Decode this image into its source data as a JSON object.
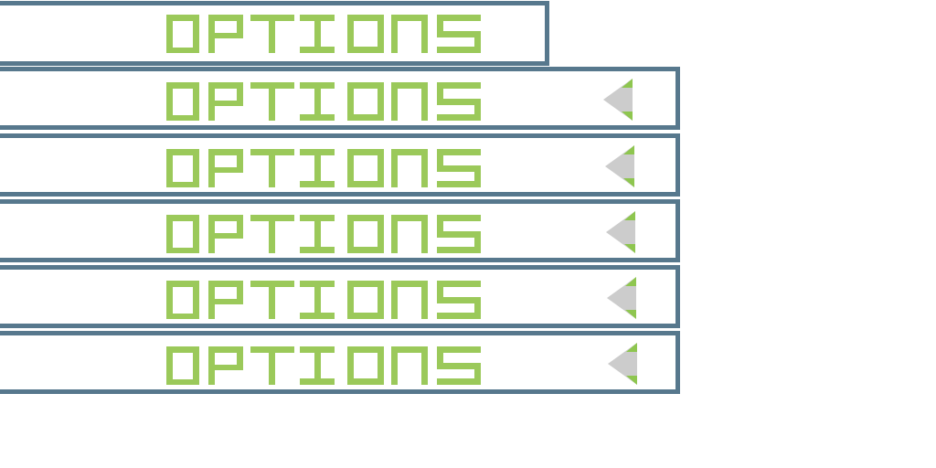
{
  "menu": {
    "buttons": [
      {
        "label": "OPTIONS"
      },
      {
        "label": "OPTIONS"
      },
      {
        "label": "OPTIONS"
      },
      {
        "label": "OPTIONS"
      },
      {
        "label": "OPTIONS"
      },
      {
        "label": "OPTIONS"
      }
    ],
    "arrow_icon": "left-triangle-icon"
  },
  "colors": {
    "border": "#57788d",
    "text": "#9bc95a",
    "arrow_fill": "#cccccc",
    "arrow_accent": "#8ec64f",
    "background": "#ffffff"
  }
}
